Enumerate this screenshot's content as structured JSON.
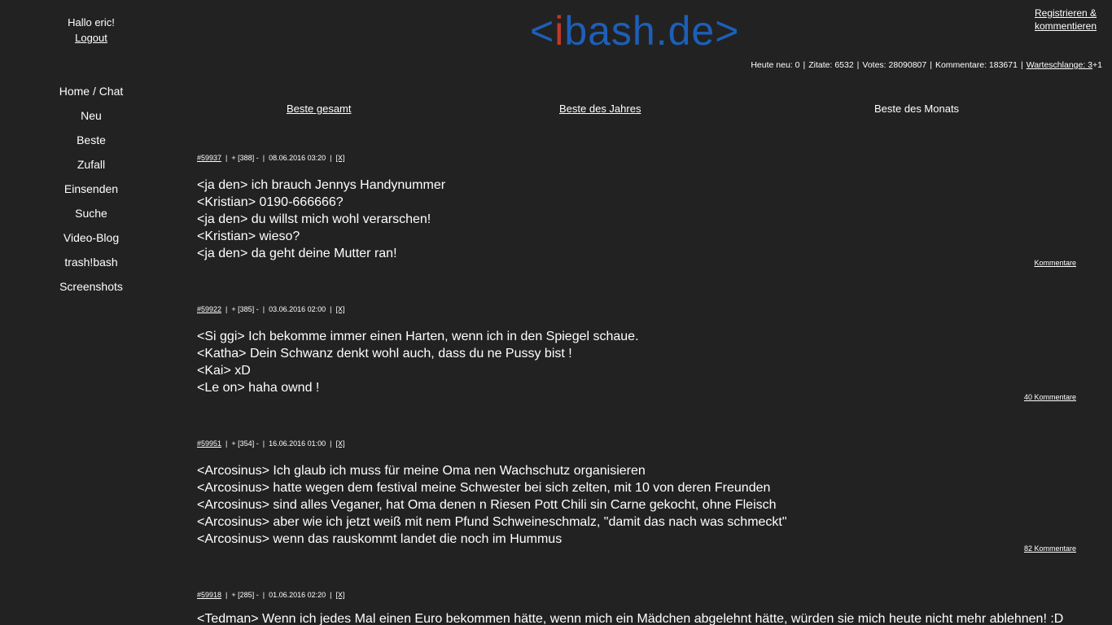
{
  "header": {
    "greeting": "Hallo eric!",
    "logout_label": "Logout",
    "logo_prefix": "<",
    "logo_i": "i",
    "logo_rest": "bash.de>",
    "register_line1": "Registrieren &",
    "register_line2": "kommentieren"
  },
  "stats": {
    "today": "Heute neu: 0",
    "quotes": "Zitate: 6532",
    "votes": "Votes: 28090807",
    "comments": "Kommentare: 183671",
    "queue_label": "Warteschlange: 3",
    "queue_extra": "+1"
  },
  "nav": {
    "home": "Home / Chat",
    "new": "Neu",
    "best": "Beste",
    "random": "Zufall",
    "submit": "Einsenden",
    "search": "Suche",
    "video_blog": "Video-Blog",
    "trashbash": "trash!bash",
    "screenshots": "Screenshots"
  },
  "best_tabs": {
    "overall": "Beste gesamt",
    "year": "Beste des Jahres",
    "month": "Beste des Monats"
  },
  "quotes": [
    {
      "id": "#59937",
      "plus": "+",
      "score": "[388]",
      "minus": "-",
      "date": "08.06.2016 03:20",
      "flag": "[X]",
      "lines": [
        "<ja den> ich brauch Jennys Handynummer",
        "<Kristian> 0190-666666?",
        "<ja den> du willst mich wohl verarschen!",
        "<Kristian> wieso?",
        "<ja den> da geht deine Mutter ran!"
      ],
      "comments": "Kommentare"
    },
    {
      "id": "#59922",
      "plus": "+",
      "score": "[385]",
      "minus": "-",
      "date": "03.06.2016 02:00",
      "flag": "[X]",
      "lines": [
        "<Si ggi> Ich bekomme immer einen Harten, wenn ich in den Spiegel schaue.",
        "<Katha> Dein Schwanz denkt wohl auch, dass du ne Pussy bist !",
        "<Kai> xD",
        "<Le on> haha ownd !"
      ],
      "comments": "40 Kommentare"
    },
    {
      "id": "#59951",
      "plus": "+",
      "score": "[354]",
      "minus": "-",
      "date": "16.06.2016 01:00",
      "flag": "[X]",
      "lines": [
        "<Arcosinus> Ich glaub ich muss für meine Oma nen Wachschutz organisieren",
        "<Arcosinus> hatte wegen dem festival meine Schwester bei sich zelten, mit 10 von deren Freunden",
        "<Arcosinus> sind alles Veganer, hat Oma denen n Riesen Pott Chili sin Carne gekocht, ohne Fleisch",
        "<Arcosinus> aber wie ich jetzt weiß mit nem Pfund Schweineschmalz, \"damit das nach was schmeckt\"",
        "<Arcosinus> wenn das rauskommt landet die noch im Hummus"
      ],
      "comments": "82 Kommentare"
    },
    {
      "id": "#59918",
      "plus": "+",
      "score": "[285]",
      "minus": "-",
      "date": "01.06.2016 02:20",
      "flag": "[X]",
      "lines": [
        "<Tedman> Wenn ich jedes Mal einen Euro bekommen hätte, wenn mich ein Mädchen abgelehnt hätte, würden sie mich heute nicht mehr ablehnen! :D"
      ],
      "comments": ""
    }
  ]
}
